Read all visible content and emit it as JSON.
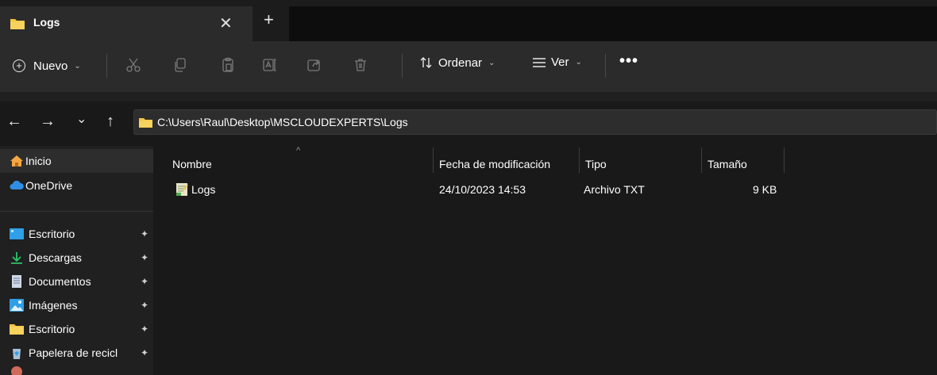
{
  "tab": {
    "title": "Logs",
    "close_glyph": "✕",
    "new_glyph": "+"
  },
  "toolbar": {
    "new_label": "Nuevo",
    "sort_label": "Ordenar",
    "view_label": "Ver",
    "more_glyph": "•••",
    "chevron": "⌄",
    "icons": [
      "cut-icon",
      "copy-icon",
      "paste-icon",
      "rename-icon",
      "share-icon",
      "delete-icon"
    ]
  },
  "nav": {
    "back": "←",
    "forward": "→",
    "recent": "⌄",
    "up": "↑"
  },
  "address": {
    "path": "C:\\Users\\Raul\\Desktop\\MSCLOUDEXPERTS\\Logs"
  },
  "sidebar": {
    "items": [
      {
        "label": "Inicio",
        "icon": "home-icon",
        "pinned": false
      },
      {
        "label": "OneDrive",
        "icon": "cloud-icon",
        "pinned": false
      },
      {
        "label": "Escritorio",
        "icon": "desktop-icon",
        "pinned": true
      },
      {
        "label": "Descargas",
        "icon": "download-icon",
        "pinned": true
      },
      {
        "label": "Documentos",
        "icon": "document-icon",
        "pinned": true
      },
      {
        "label": "Imágenes",
        "icon": "pictures-icon",
        "pinned": true
      },
      {
        "label": "Escritorio",
        "icon": "folder-icon",
        "pinned": true
      },
      {
        "label": "Papelera de recicl",
        "icon": "recycle-bin-icon",
        "pinned": true
      }
    ],
    "pin_glyph": "📌"
  },
  "columns": {
    "name": "Nombre",
    "modified": "Fecha de modificación",
    "type": "Tipo",
    "size": "Tamaño",
    "sort_caret": "^"
  },
  "files": [
    {
      "name": "Logs",
      "modified": "24/10/2023 14:53",
      "type": "Archivo TXT",
      "size": "9 KB"
    }
  ],
  "colors": {
    "accent_folder": "#f4c542",
    "cloud": "#2f8fe6",
    "background": "#191919",
    "sidebar": "#202020"
  }
}
